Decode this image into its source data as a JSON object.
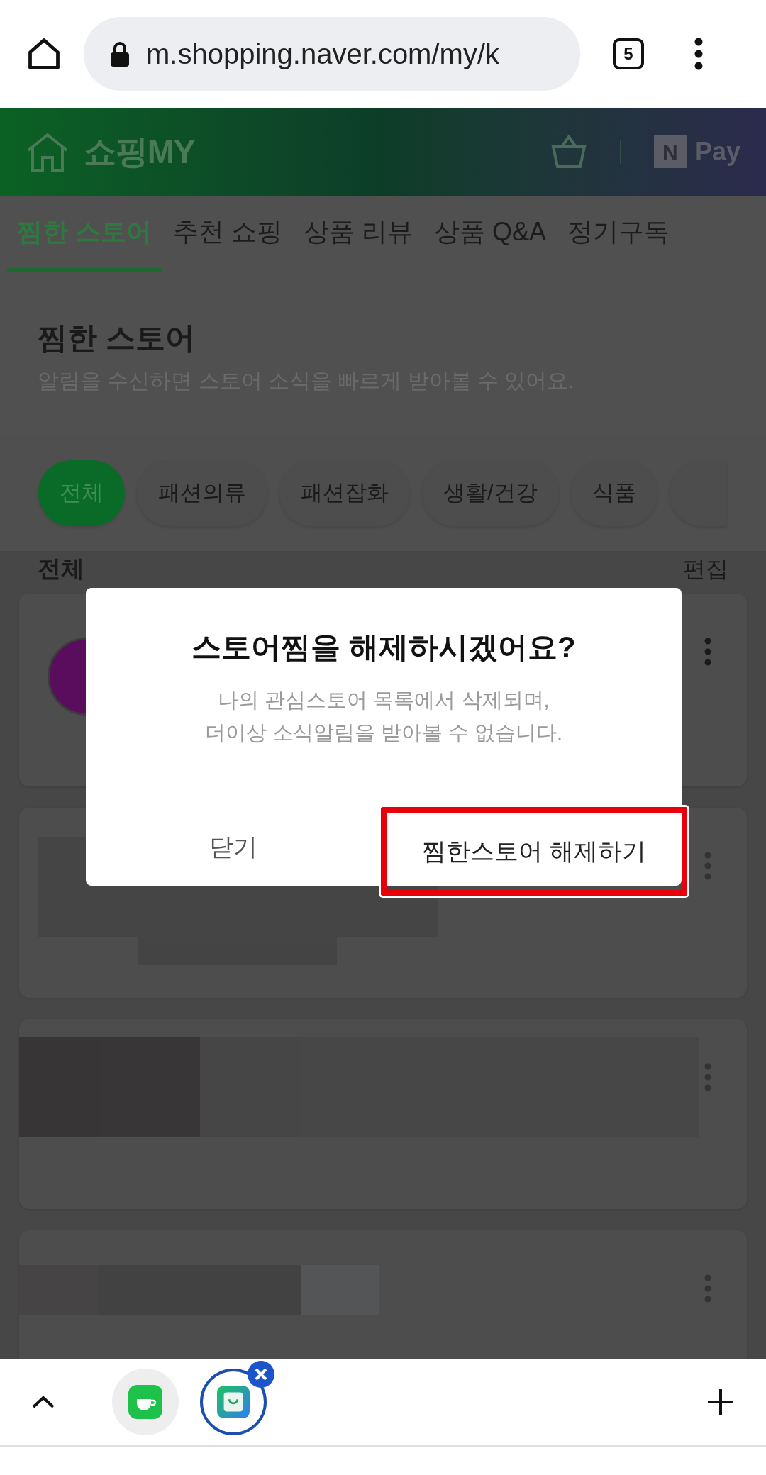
{
  "browser": {
    "url": "m.shopping.naver.com/my/k",
    "tab_count": "5"
  },
  "header": {
    "title": "쇼핑MY",
    "pay_badge": "N",
    "pay_label": "Pay"
  },
  "tabs": [
    {
      "label": "찜한 스토어",
      "selected": true
    },
    {
      "label": "추천 쇼핑",
      "selected": false
    },
    {
      "label": "상품 리뷰",
      "selected": false
    },
    {
      "label": "상품 Q&A",
      "selected": false
    },
    {
      "label": "정기구독",
      "selected": false
    }
  ],
  "page": {
    "title": "찜한 스토어",
    "subtitle": "알림을 수신하면 스토어 소식을 빠르게 받아볼 수 있어요.",
    "chips": [
      {
        "label": "전체",
        "selected": true
      },
      {
        "label": "패션의류",
        "selected": false
      },
      {
        "label": "패션잡화",
        "selected": false
      },
      {
        "label": "생활/건강",
        "selected": false
      },
      {
        "label": "식품",
        "selected": false
      }
    ],
    "section_title": "전체",
    "edit_label": "편집"
  },
  "dialog": {
    "title": "스토어찜을 해제하시겠어요?",
    "message": [
      "나의 관심스토어 목록에서 삭제되며,",
      "더이상 소식알림을 받아볼 수 없습니다."
    ],
    "buttons": [
      {
        "label": "닫기",
        "highlighted": false
      },
      {
        "label": "찜한스토어 해제하기",
        "highlighted": true
      }
    ]
  },
  "tab_strip": [
    {
      "selected": false
    },
    {
      "selected": true
    }
  ]
}
